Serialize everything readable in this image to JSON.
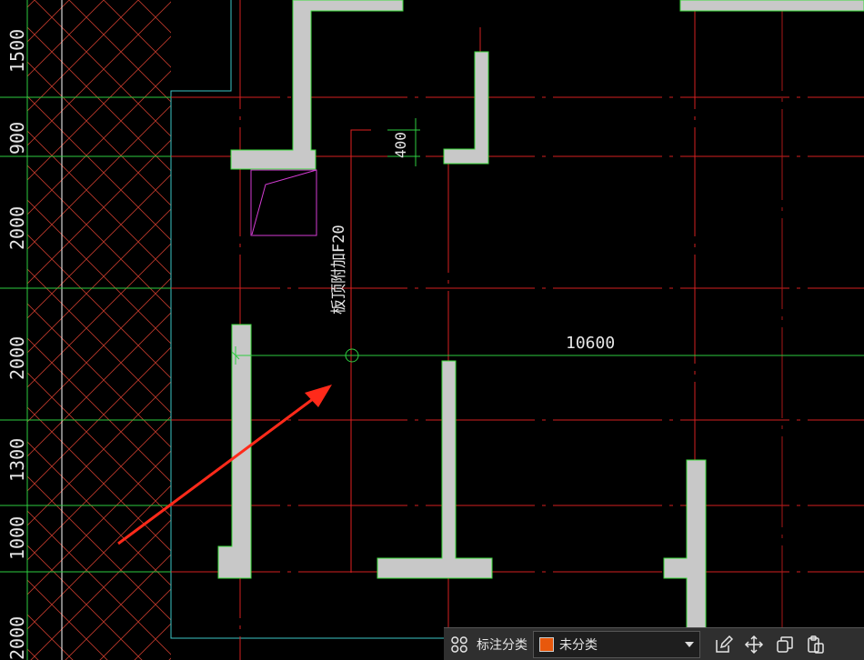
{
  "drawing": {
    "dimensions_left": [
      "1500",
      "900",
      "2000",
      "2000",
      "1300",
      "1000",
      "2000"
    ],
    "dimension_small": "400",
    "dimension_long": "10600",
    "rebar_note": "板顶附加F20"
  },
  "toolbar": {
    "label": "标注分类",
    "select_value": "未分类",
    "swatch_color": "#e8580c",
    "icons": [
      "grid-icon",
      "edit-icon",
      "move-icon",
      "copy-icon",
      "paste-icon"
    ]
  }
}
